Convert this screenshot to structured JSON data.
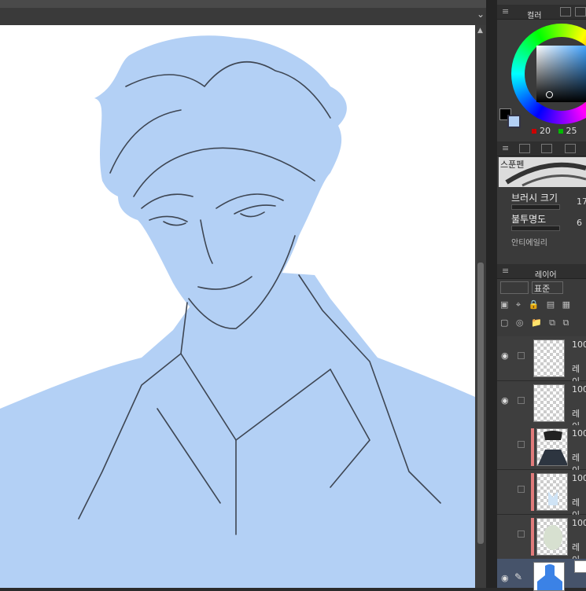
{
  "colors": {
    "sketch_fill": "#b3d0f5",
    "canvas": "#ffffff",
    "panel": "#3a3a3a",
    "layer_mark": "#e07b7b"
  },
  "color_panel": {
    "tab_label": "컬러",
    "values": [
      "20",
      "25"
    ]
  },
  "brush_panel": {
    "brush_name": "스푼펜",
    "brush_size_label": "브러시 크기",
    "brush_size_value": "17",
    "opacity_label": "불투명도",
    "opacity_value": "6",
    "antialias_label": "안티에일리"
  },
  "layer_panel": {
    "tab_label": "레이어",
    "blend_mode": "표준",
    "layers": [
      {
        "opacity": "100",
        "name": "레이"
      },
      {
        "opacity": "100",
        "name": "레이"
      },
      {
        "opacity": "100",
        "name": "레이"
      },
      {
        "opacity": "100",
        "name": "레이"
      },
      {
        "opacity": "100",
        "name": "레이"
      }
    ]
  },
  "icons": [
    "menu-icon",
    "chevron-down-icon",
    "eye-icon",
    "pen-icon",
    "folder-icon",
    "lock-icon"
  ]
}
